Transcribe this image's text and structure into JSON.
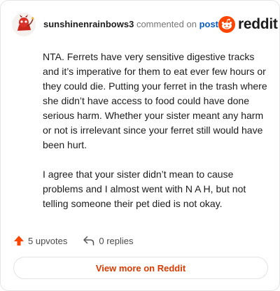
{
  "header": {
    "username": "sunshinenrainbows3",
    "verb": "commented on",
    "post_link": "post",
    "logo_text": "reddit"
  },
  "comment": {
    "paragraphs": [
      "NTA. Ferrets have very sensitive digestive tracks and it’s imperative for them to eat ever few hours or they could die. Putting your ferret in the trash where she didn’t have access to food could have done serious harm. Whether your sister meant any harm or not is irrelevant since your ferret still would have been hurt.",
      "I agree that your sister didn’t mean to cause problems and I almost went with N A H, but not telling someone their pet died is not okay."
    ]
  },
  "actions": {
    "upvotes": "5 upvotes",
    "replies": "0 replies"
  },
  "footer": {
    "view_more": "View more on Reddit"
  },
  "colors": {
    "reddit_orange": "#ff4500",
    "link_blue": "#0a5bc4",
    "button_text": "#d93a00"
  },
  "icons": {
    "upvote": "upvote-arrow-icon",
    "reply": "reply-arrow-icon",
    "logo": "reddit-snoo-icon"
  }
}
